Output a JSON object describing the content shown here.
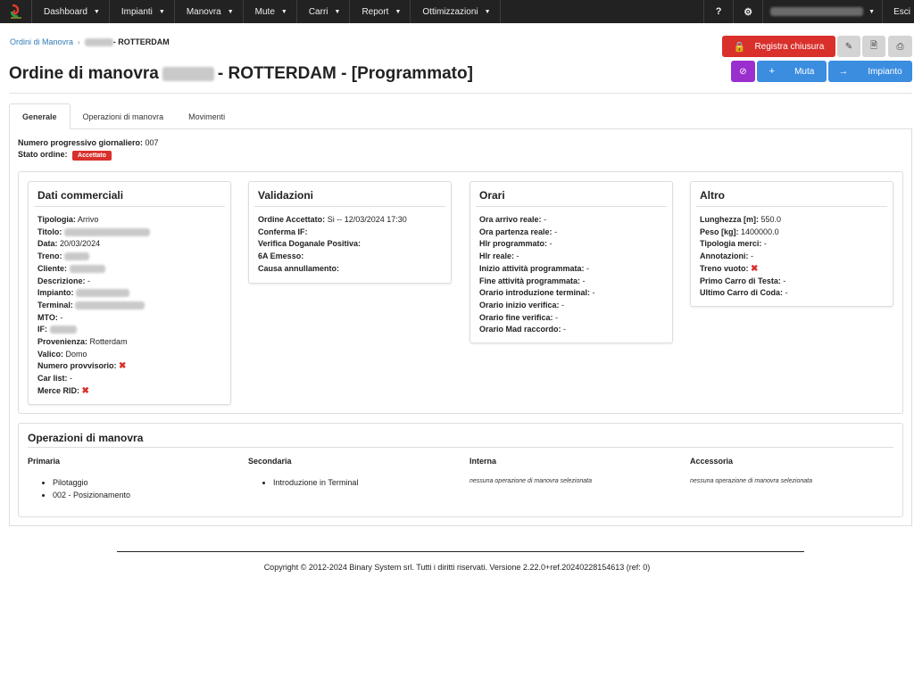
{
  "nav": {
    "items": [
      {
        "label": "Dashboard"
      },
      {
        "label": "Impianti"
      },
      {
        "label": "Manovra"
      },
      {
        "label": "Mute"
      },
      {
        "label": "Carri"
      },
      {
        "label": "Report"
      },
      {
        "label": "Ottimizzazioni"
      }
    ],
    "help_label": "?",
    "logout_label": "Esci"
  },
  "breadcrumb": {
    "link": "Ordini di Manovra",
    "current": "- ROTTERDAM"
  },
  "title": {
    "prefix": "Ordine di manovra",
    "suffix": "- ROTTERDAM - [Programmato]"
  },
  "actions": {
    "registra": "Registra chiusura",
    "muta": "Muta",
    "impianto": "Impianto"
  },
  "tabs": [
    {
      "label": "Generale"
    },
    {
      "label": "Operazioni di manovra"
    },
    {
      "label": "Movimenti"
    }
  ],
  "meta": {
    "progressivo_label": "Numero progressivo giornaliero:",
    "progressivo_value": "007",
    "stato_label": "Stato ordine:",
    "stato_value": "Accettato"
  },
  "dati_commerciali": {
    "title": "Dati commerciali",
    "rows": [
      {
        "label": "Tipologia:",
        "value": "Arrivo"
      },
      {
        "label": "Titolo:",
        "value": ""
      },
      {
        "label": "Data:",
        "value": "20/03/2024"
      },
      {
        "label": "Treno:",
        "value": ""
      },
      {
        "label": "Cliente:",
        "value": ""
      },
      {
        "label": "Descrizione:",
        "value": "-"
      },
      {
        "label": "Impianto:",
        "value": ""
      },
      {
        "label": "Terminal:",
        "value": ""
      },
      {
        "label": "MTO:",
        "value": "-"
      },
      {
        "label": "IF:",
        "value": ""
      },
      {
        "label": "Provenienza:",
        "value": "Rotterdam"
      },
      {
        "label": "Valico:",
        "value": "Domo"
      },
      {
        "label": "Numero provvisorio:",
        "value": ""
      },
      {
        "label": "Car list:",
        "value": "-"
      },
      {
        "label": "Merce RID:",
        "value": ""
      }
    ]
  },
  "validazioni": {
    "title": "Validazioni",
    "rows": [
      {
        "label": "Ordine Accettato:",
        "value": "Si -- 12/03/2024 17:30"
      },
      {
        "label": "Conferma IF:",
        "value": ""
      },
      {
        "label": "Verifica Doganale Positiva:",
        "value": ""
      },
      {
        "label": "6A Emesso:",
        "value": ""
      },
      {
        "label": "Causa annullamento:",
        "value": ""
      }
    ]
  },
  "orari": {
    "title": "Orari",
    "rows": [
      {
        "label": "Ora arrivo reale:",
        "value": "-"
      },
      {
        "label": "Ora partenza reale:",
        "value": "-"
      },
      {
        "label": "Hlr programmato:",
        "value": "-"
      },
      {
        "label": "Hlr reale:",
        "value": "-"
      },
      {
        "label": "Inizio attività programmata:",
        "value": "-"
      },
      {
        "label": "Fine attività programmata:",
        "value": "-"
      },
      {
        "label": "Orario introduzione terminal:",
        "value": "-"
      },
      {
        "label": "Orario inizio verifica:",
        "value": "-"
      },
      {
        "label": "Orario fine verifica:",
        "value": "-"
      },
      {
        "label": "Orario Mad raccordo:",
        "value": "-"
      }
    ]
  },
  "altro": {
    "title": "Altro",
    "rows": [
      {
        "label": "Lunghezza [m]:",
        "value": "550.0"
      },
      {
        "label": "Peso [kg]:",
        "value": "1400000.0"
      },
      {
        "label": "Tipologia merci:",
        "value": "-"
      },
      {
        "label": "Annotazioni:",
        "value": "-"
      },
      {
        "label": "Treno vuoto:",
        "value": ""
      },
      {
        "label": "Primo Carro di Testa:",
        "value": "-"
      },
      {
        "label": "Ultimo Carro di Coda:",
        "value": "-"
      }
    ]
  },
  "operazioni": {
    "title": "Operazioni di manovra",
    "primaria": {
      "title": "Primaria",
      "items": [
        "Pilotaggio",
        "002 - Posizionamento"
      ]
    },
    "secondaria": {
      "title": "Secondaria",
      "items": [
        "Introduzione in Terminal"
      ]
    },
    "interna": {
      "title": "Interna",
      "none": "nessuna operazione di manovra selezionata"
    },
    "accessoria": {
      "title": "Accessoria",
      "none": "nessuna operazione di manovra selezionata"
    }
  },
  "footer": "Copyright © 2012-2024 Binary System srl. Tutti i diritti riservati. Versione 2.22.0+ref.20240228154613 (ref: 0)",
  "colors": {
    "nav_bg": "#222222",
    "danger": "#d9302c",
    "primary": "#3b8de0",
    "purple": "#9b2fce",
    "link": "#337ab7"
  }
}
